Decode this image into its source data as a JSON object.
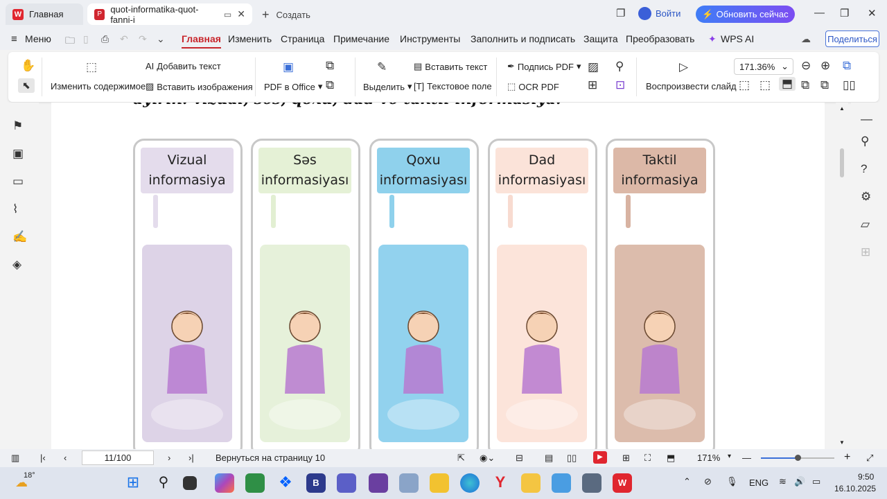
{
  "tabs": {
    "home": "Главная",
    "doc": "quot-informatika-quot-fanni-i",
    "new": "Создать"
  },
  "header": {
    "login": "Войти",
    "update": "Обновить сейчас"
  },
  "menu": {
    "menu_label": "Меню",
    "items": [
      "Главная",
      "Изменить",
      "Страница",
      "Примечание",
      "Инструменты",
      "Заполнить и подписать",
      "Защита",
      "Преобразовать",
      "WPS AI"
    ],
    "share": "Поделиться"
  },
  "toolbar": {
    "edit_content": "Изменить содержимое",
    "add_text": "Добавить текст",
    "insert_image": "Вставить изображения",
    "pdf_office": "PDF в Office",
    "select": "Выделить",
    "insert_text": "Вставить текст",
    "text_field": "Текстовое поле",
    "sign_pdf": "Подпись PDF",
    "ocr_pdf": "OCR PDF",
    "play_slide": "Воспроизвести слайд",
    "zoom": "171.36%"
  },
  "document": {
    "headline": "ayırın: vizual, səs, qoxu, dad və taktil informasiya.",
    "cards": [
      {
        "line1": "Vizual",
        "line2": "informasiya",
        "label_color": "#e4dcec",
        "stem_color": "#e4dcec",
        "bg": "#ddd3e7"
      },
      {
        "line1": "Səs",
        "line2": "informasiyası",
        "label_color": "#e5f1d6",
        "stem_color": "#e2efd2",
        "bg": "#e6f1da"
      },
      {
        "line1": "Qoxu",
        "line2": "informasiyası",
        "label_color": "#8fd1ec",
        "stem_color": "#8fd1ec",
        "bg": "#92d2ee"
      },
      {
        "line1": "Dad",
        "line2": "informasiyası",
        "label_color": "#fbe3d9",
        "stem_color": "#f8dbd0",
        "bg": "#fce4da"
      },
      {
        "line1": "Taktil",
        "line2": "informasiya",
        "label_color": "#dcb8a7",
        "stem_color": "#d8b3a2",
        "bg": "#dcbcac"
      }
    ]
  },
  "status": {
    "page": "11/100",
    "back": "Вернуться на страницу 10",
    "zoom": "171%"
  },
  "taskbar": {
    "temp": "18°",
    "lang": "ENG",
    "time": "9:50",
    "date": "16.10.2025"
  }
}
